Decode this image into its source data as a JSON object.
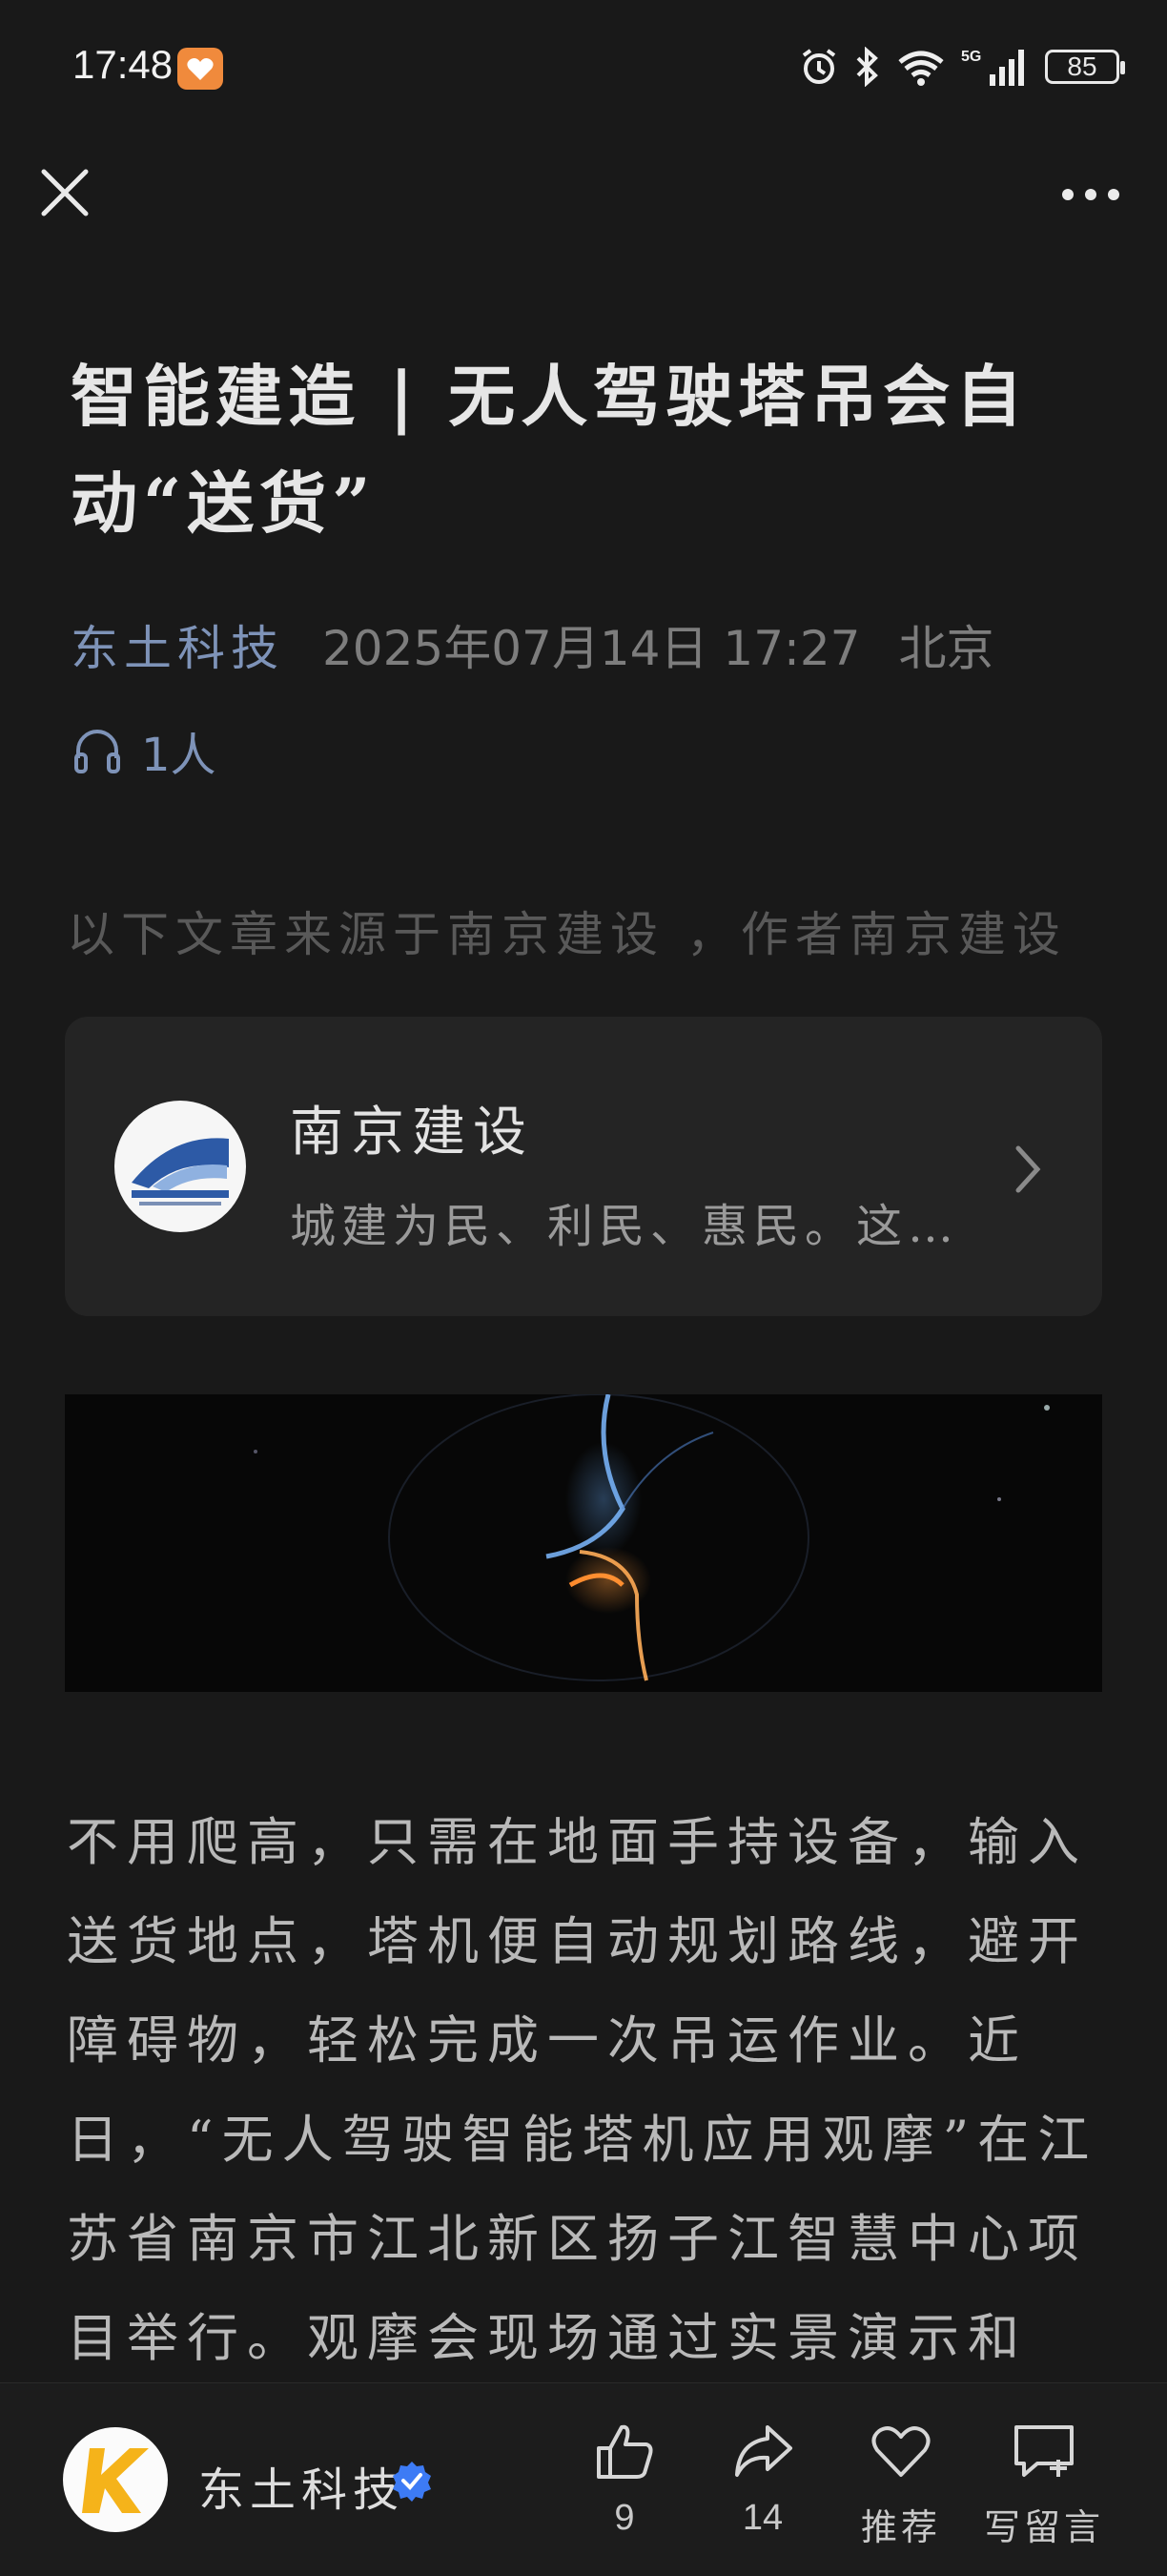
{
  "status_bar": {
    "time": "17:48",
    "battery": "85",
    "network": "5G"
  },
  "icons": {
    "close": "close-icon",
    "more": "more-icon",
    "listen": "headphones-icon",
    "card_arrow": "chevron-right-icon",
    "like": "thumbs-up-icon",
    "share": "share-icon",
    "recommend": "heart-icon",
    "comment": "comment-icon"
  },
  "article": {
    "title": "智能建造 | 无人驾驶塔吊会自动“送货”",
    "author": "东土科技",
    "date": "2025年07月14日 17:27",
    "location": "北京",
    "listeners": "1人",
    "source_note": "以下文章来源于南京建设 ，作者南京建设",
    "body": "不用爬高，只需在地面手持设备，输入送货地点，塔机便自动规划路线，避开障碍物，轻松完成一次吊运作业。近日，“无人驾驶智能塔机应用观摩”在江苏省南京市江北新区扬子江智慧中心项目举行。观摩会现场通过实景演示和"
  },
  "source_card": {
    "name": "南京建设",
    "description": "城建为民、利民、惠民。这…"
  },
  "bottom_bar": {
    "account_name": "东土科技",
    "like_count": "9",
    "share_count": "14",
    "recommend_label": "推荐",
    "comment_label": "写留言"
  },
  "colors": {
    "background": "#191919",
    "author_accent": "#7e93b8",
    "verified_badge": "#3d7bf5"
  }
}
